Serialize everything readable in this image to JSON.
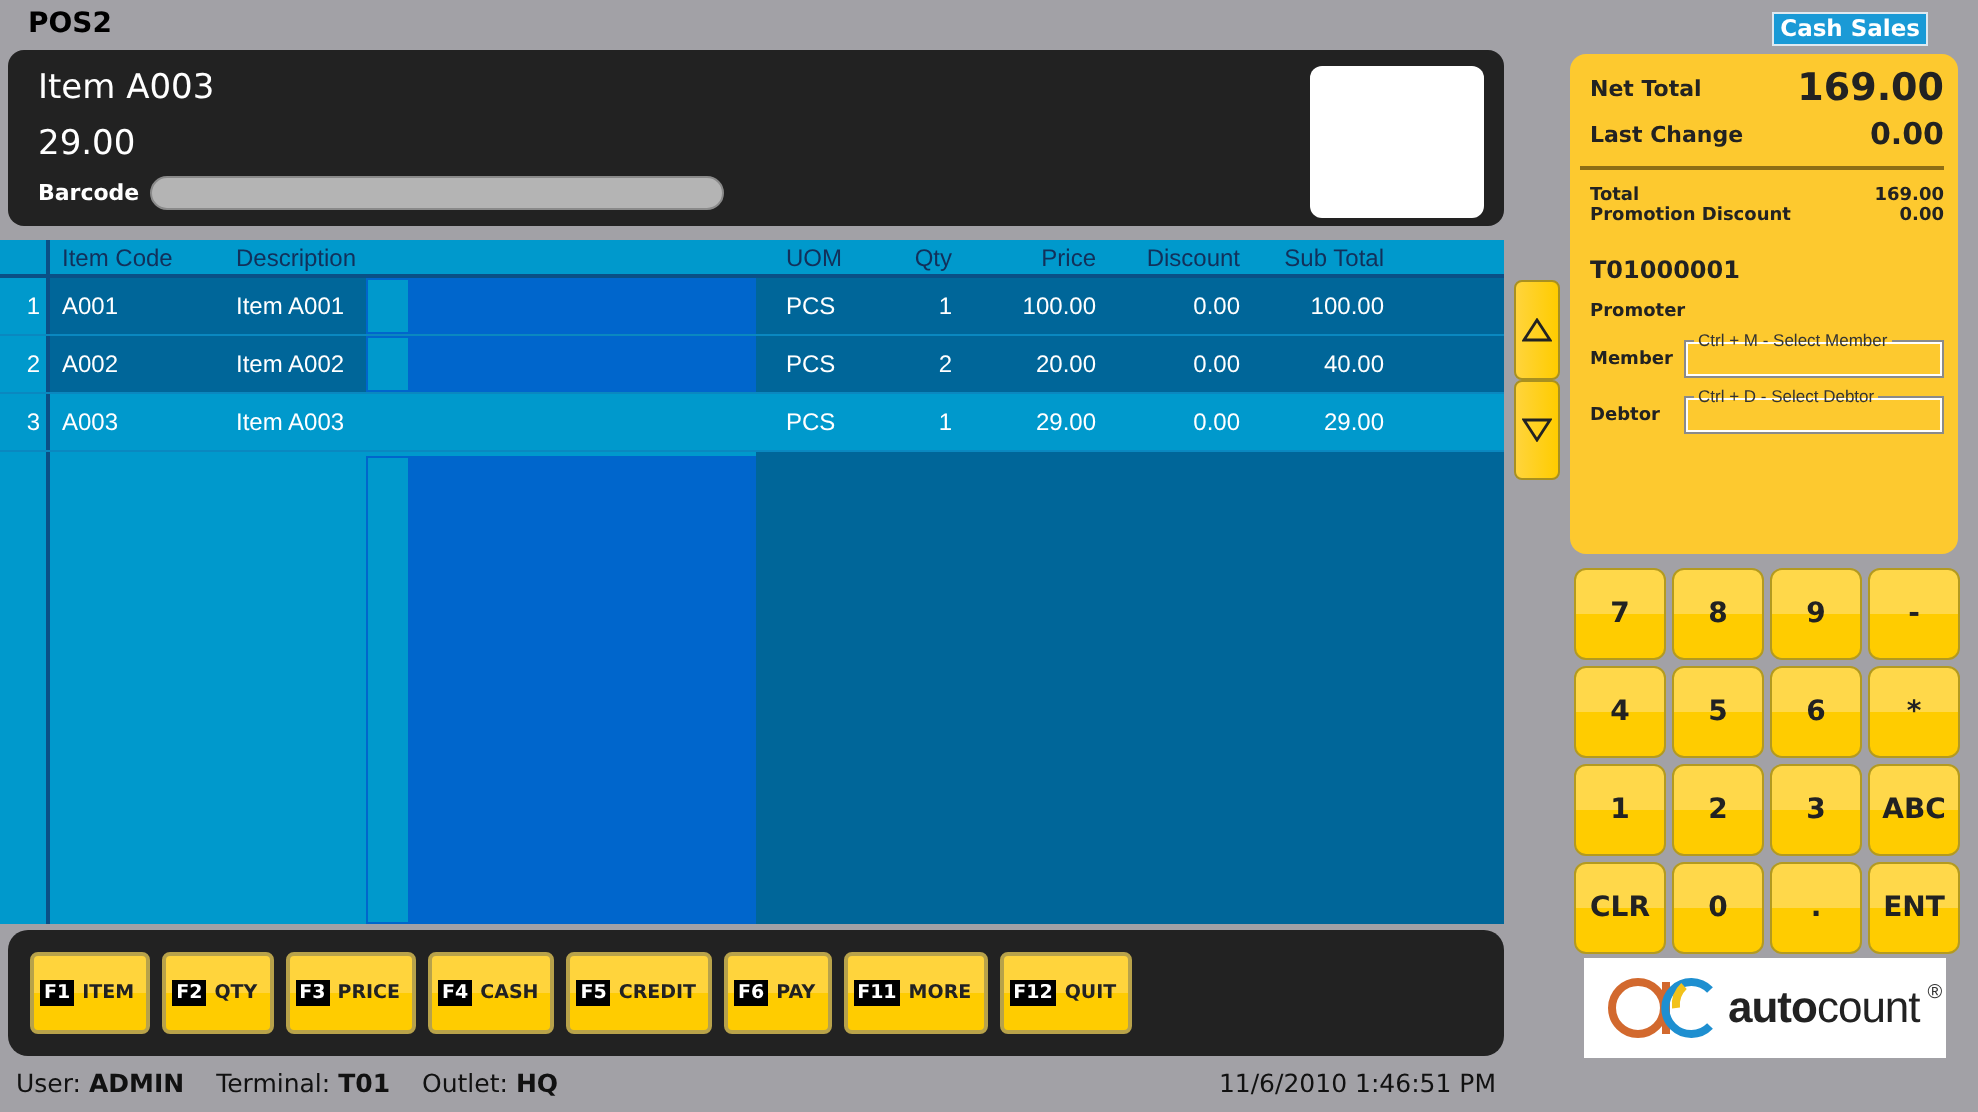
{
  "window": {
    "title": "POS2"
  },
  "mode_button": "Cash Sales",
  "item_display": {
    "name": "Item A003",
    "price": "29.00",
    "barcode_label": "Barcode"
  },
  "grid": {
    "columns": [
      "Item Code",
      "Description",
      "UOM",
      "Qty",
      "Price",
      "Discount",
      "Sub Total"
    ],
    "rows": [
      {
        "no": "1",
        "item_code": "A001",
        "description": "Item A001",
        "uom": "PCS",
        "qty": "1",
        "price": "100.00",
        "discount": "0.00",
        "sub_total": "100.00",
        "selected": false
      },
      {
        "no": "2",
        "item_code": "A002",
        "description": "Item A002",
        "uom": "PCS",
        "qty": "2",
        "price": "20.00",
        "discount": "0.00",
        "sub_total": "40.00",
        "selected": false
      },
      {
        "no": "3",
        "item_code": "A003",
        "description": "Item A003",
        "uom": "PCS",
        "qty": "1",
        "price": "29.00",
        "discount": "0.00",
        "sub_total": "29.00",
        "selected": true
      }
    ]
  },
  "summary": {
    "net_total_label": "Net Total",
    "net_total": "169.00",
    "last_change_label": "Last Change",
    "last_change": "0.00",
    "details": [
      {
        "label": "Total",
        "value": "169.00"
      },
      {
        "label": "Promotion Discount",
        "value": "0.00"
      }
    ],
    "receipt_no": "T01000001",
    "promoter_label": "Promoter",
    "member_label": "Member",
    "member_hint": "Ctrl + M - Select Member",
    "debtor_label": "Debtor",
    "debtor_hint": "Ctrl + D - Select Debtor"
  },
  "keypad": [
    "7",
    "8",
    "9",
    "-",
    "4",
    "5",
    "6",
    "*",
    "1",
    "2",
    "3",
    "ABC",
    "CLR",
    "0",
    ".",
    "ENT"
  ],
  "function_keys": [
    {
      "key": "F1",
      "label": "ITEM"
    },
    {
      "key": "F2",
      "label": "QTY"
    },
    {
      "key": "F3",
      "label": "PRICE"
    },
    {
      "key": "F4",
      "label": "CASH"
    },
    {
      "key": "F5",
      "label": "CREDIT"
    },
    {
      "key": "F6",
      "label": "PAY"
    },
    {
      "key": "F11",
      "label": "MORE"
    },
    {
      "key": "F12",
      "label": "QUIT"
    }
  ],
  "status": [
    {
      "label": "User:",
      "value": "ADMIN"
    },
    {
      "label": "Terminal:",
      "value": "T01"
    },
    {
      "label": "Outlet:",
      "value": "HQ"
    }
  ],
  "datetime": "11/6/2010 1:46:51 PM",
  "logo": {
    "wordmark": "**auto**count",
    "mark": "®"
  }
}
